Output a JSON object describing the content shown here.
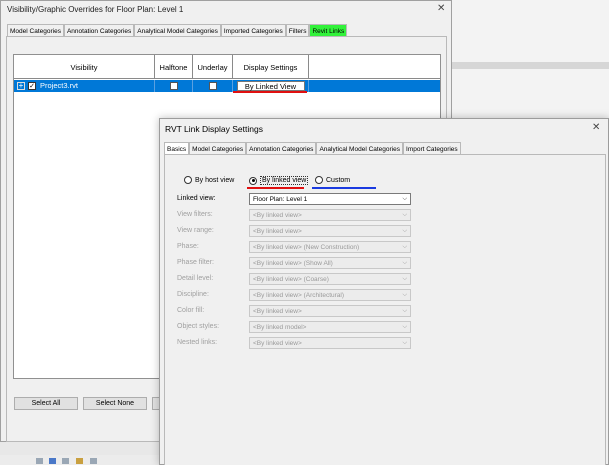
{
  "vg_dialog": {
    "title": "Visibility/Graphic Overrides for Floor Plan: Level 1",
    "close": "✕",
    "tabs": [
      "Model Categories",
      "Annotation Categories",
      "Analytical Model Categories",
      "Imported Categories",
      "Filters",
      "Revit Links"
    ],
    "highlight_tab": "Revit Links",
    "columns": [
      "Visibility",
      "Halftone",
      "Underlay",
      "Display Settings"
    ],
    "row": {
      "expander": "+",
      "checked": "✓",
      "name": "Project3.rvt",
      "display_setting": "By Linked View"
    },
    "buttons": {
      "select_all": "Select All",
      "select_none": "Select None"
    }
  },
  "rvt_dialog": {
    "title": "RVT Link Display Settings",
    "close": "✕",
    "tabs": [
      "Basics",
      "Model Categories",
      "Annotation Categories",
      "Analytical Model Categories",
      "Import Categories"
    ],
    "active_tab": "Basics",
    "radios": {
      "by_host": "By host view",
      "by_linked": "By linked view",
      "custom": "Custom",
      "selected": "By linked view"
    },
    "fields": [
      {
        "label": "Linked view:",
        "value": "Floor Plan: Level 1",
        "enabled": true
      },
      {
        "label": "View filters:",
        "value": "<By linked view>",
        "enabled": false
      },
      {
        "label": "View range:",
        "value": "<By linked view>",
        "enabled": false
      },
      {
        "label": "Phase:",
        "value": "<By linked view> (New Construction)",
        "enabled": false
      },
      {
        "label": "Phase filter:",
        "value": "<By linked view> (Show All)",
        "enabled": false
      },
      {
        "label": "Detail level:",
        "value": "<By linked view> (Coarse)",
        "enabled": false
      },
      {
        "label": "Discipline:",
        "value": "<By linked view> (Architectural)",
        "enabled": false
      },
      {
        "label": "Color fill:",
        "value": "<By linked view>",
        "enabled": false
      },
      {
        "label": "Object styles:",
        "value": "<By linked model>",
        "enabled": false
      },
      {
        "label": "Nested links:",
        "value": "<By linked view>",
        "enabled": false
      }
    ],
    "dropdown_arrow": "⌵"
  },
  "colors": {
    "selection": "#0078d7",
    "highlight_tab": "#32f23a",
    "red_mark": "#e01010",
    "blue_mark": "#1a3ae0"
  }
}
